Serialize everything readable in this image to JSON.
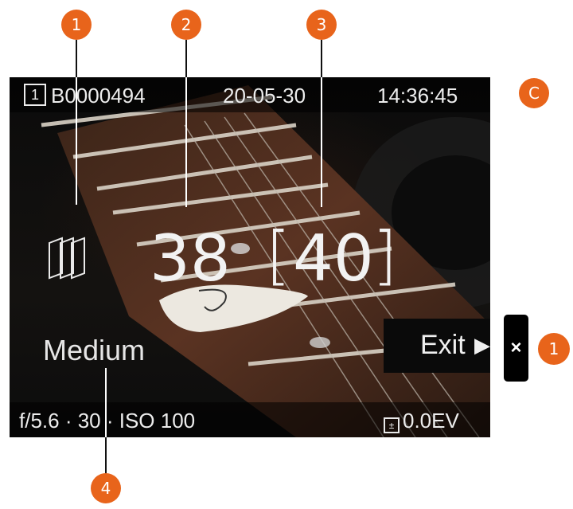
{
  "callouts": {
    "c1": "1",
    "c2": "2",
    "c3": "3",
    "c4": "4",
    "side": "C",
    "exit_callout": "1"
  },
  "topbar": {
    "card": "1",
    "file": "B0000494",
    "date": "20-05-30",
    "time": "14:36:45"
  },
  "overlay": {
    "shots": "38",
    "remaining": "40",
    "bracket_left": "[",
    "bracket_right": "]",
    "quality": "Medium"
  },
  "exit": {
    "label": "Exit",
    "arrow": "▶"
  },
  "close": {
    "glyph": "×"
  },
  "bottombar": {
    "exposure": "f/5.6 · 30 · ISO 100",
    "ev": "0.0EV"
  },
  "colors": {
    "accent": "#e8641b"
  }
}
